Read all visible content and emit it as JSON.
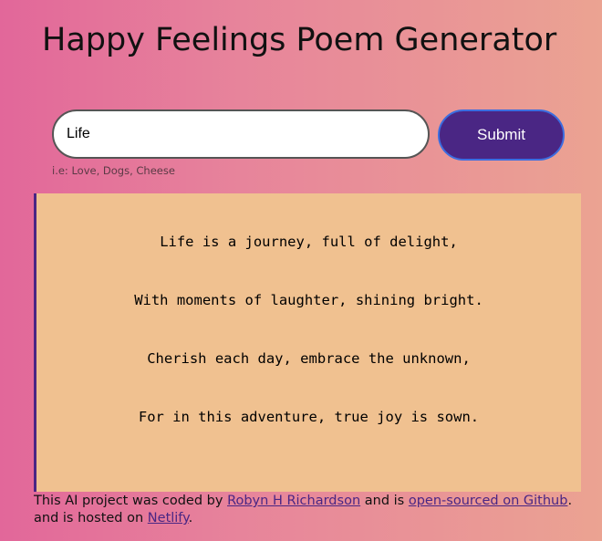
{
  "header": {
    "title": "Happy Feelings Poem Generator"
  },
  "form": {
    "input_value": "Life",
    "submit_label": "Submit",
    "hint": "i.e: Love, Dogs, Cheese"
  },
  "poem": {
    "lines": [
      "Life is a journey, full of delight,",
      "With moments of laughter, shining bright.",
      "Cherish each day, embrace the unknown,",
      "For in this adventure, true joy is sown."
    ]
  },
  "footer": {
    "text_1": "This AI project was coded by ",
    "author_link": "Robyn H Richardson",
    "text_2": " and is ",
    "github_link": "open-sourced on Github",
    "text_3": ". and is hosted on ",
    "netlify_link": "Netlify",
    "text_4": "."
  },
  "colors": {
    "accent": "#4a2684",
    "poem_background": "#f0c190",
    "gradient_start": "#e2679a",
    "gradient_end": "#eba392"
  }
}
